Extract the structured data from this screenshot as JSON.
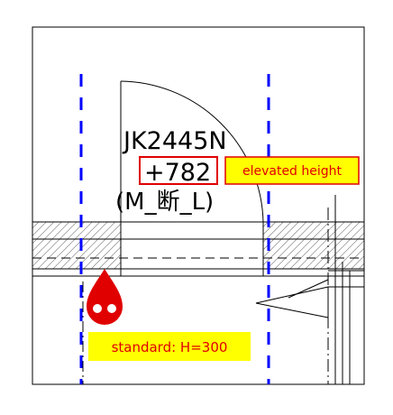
{
  "drawing": {
    "door_code": "JK2445N",
    "height_value": "+782",
    "door_type": "(M_断_L)",
    "callout_elevated": "elevated height",
    "callout_standard": "standard: H=300"
  },
  "colors": {
    "line": "#000000",
    "axis": "#0000ff",
    "hatch": "#555555",
    "highlight": "#e00000",
    "callout_fill": "#ffff00",
    "callout_text": "#e00000",
    "marker": "#e00000"
  },
  "icons": {
    "marker": "drop-pin-icon"
  }
}
